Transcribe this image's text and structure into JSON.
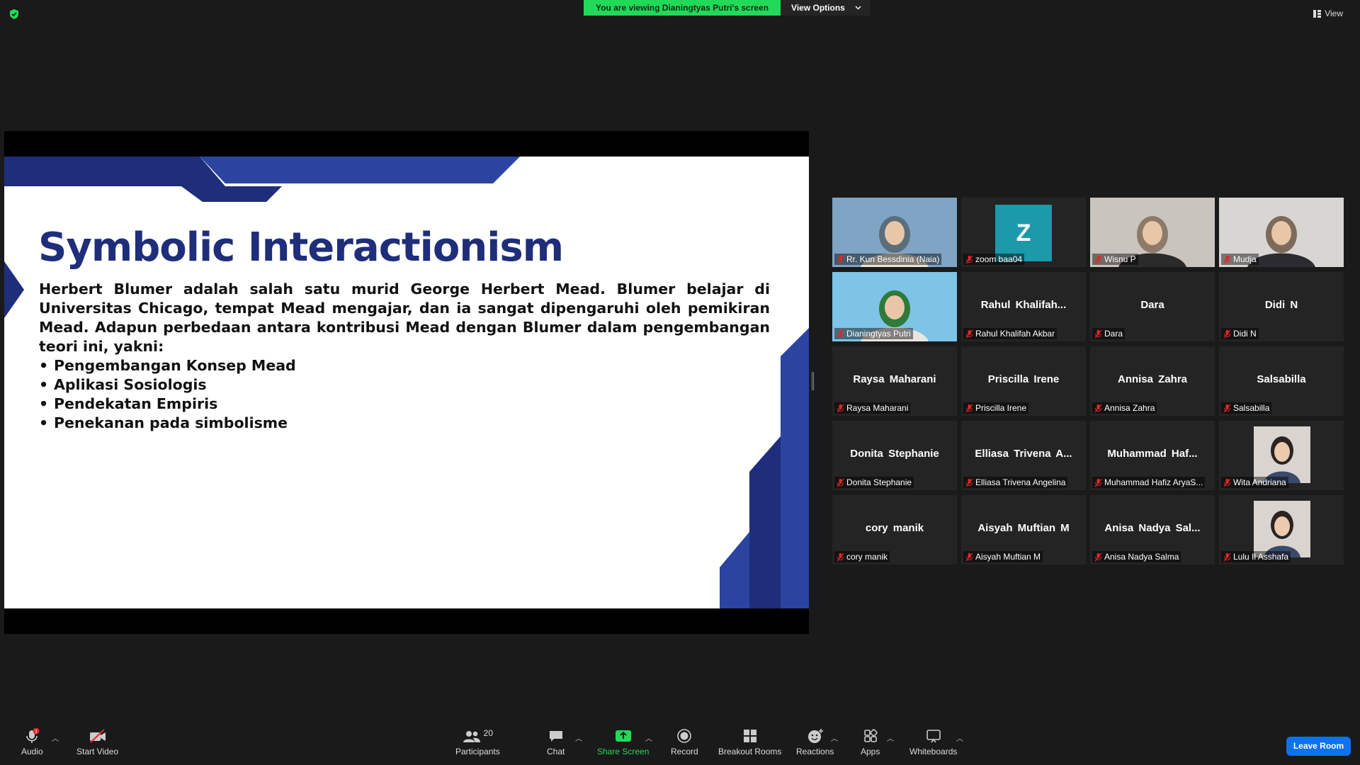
{
  "banner": {
    "viewing_text": "You are viewing Dianingtyas Putri's screen",
    "view_options_label": "View Options"
  },
  "view_label": "View",
  "slide": {
    "title": "Symbolic Interactionism",
    "paragraph": "Herbert Blumer adalah salah satu murid George Herbert Mead. Blumer belajar di Universitas Chicago, tempat Mead mengajar, dan ia sangat dipengaruhi oleh pemikiran Mead. Adapun perbedaan antara kontribusi Mead dengan Blumer dalam pengembangan teori ini, yakni:",
    "bullets": [
      "Pengembangan Konsep Mead",
      "Aplikasi Sosiologis",
      "Pendekatan Empiris",
      "Penekanan pada simbolisme"
    ]
  },
  "participants": [
    {
      "label": "Rr. Kun Bessdinia (Naia)",
      "big": "",
      "kind": "photo"
    },
    {
      "label": "zoom baa04",
      "big": "Z",
      "kind": "avatar"
    },
    {
      "label": "Wisnu P",
      "big": "",
      "kind": "photo"
    },
    {
      "label": "Mudja",
      "big": "",
      "kind": "photo"
    },
    {
      "label": "Dianingtyas Putri",
      "big": "",
      "kind": "photo",
      "active": true
    },
    {
      "label": "Rahul Khalifah Akbar",
      "big": "Rahul  Khalifah...",
      "kind": "name"
    },
    {
      "label": "Dara",
      "big": "Dara",
      "kind": "name"
    },
    {
      "label": "Didi N",
      "big": "Didi N",
      "kind": "name"
    },
    {
      "label": "Raysa Maharani",
      "big": "Raysa Maharani",
      "kind": "name"
    },
    {
      "label": "Priscilla Irene",
      "big": "Priscilla Irene",
      "kind": "name"
    },
    {
      "label": "Annisa Zahra",
      "big": "Annisa Zahra",
      "kind": "name"
    },
    {
      "label": "Salsabilla",
      "big": "Salsabilla",
      "kind": "name"
    },
    {
      "label": "Donita Stephanie",
      "big": "Donita Stephanie",
      "kind": "name"
    },
    {
      "label": "Elliasa Trivena Angelina",
      "big": "Elliasa  Trivena  A...",
      "kind": "name"
    },
    {
      "label": "Muhammad Hafiz AryaS...",
      "big": "Muhammad  Haf...",
      "kind": "name"
    },
    {
      "label": "Wita Andriana",
      "big": "",
      "kind": "thumb"
    },
    {
      "label": "cory manik",
      "big": "cory manik",
      "kind": "name"
    },
    {
      "label": "Aisyah Muftian M",
      "big": "Aisyah Muftian M",
      "kind": "name"
    },
    {
      "label": "Anisa Nadya Salma",
      "big": "Anisa  Nadya  Sal...",
      "kind": "name"
    },
    {
      "label": "Lulu Il Asshafa",
      "big": "",
      "kind": "thumb"
    }
  ],
  "toolbar": {
    "audio": "Audio",
    "start_video": "Start Video",
    "participants": "Participants",
    "participants_count": "20",
    "chat": "Chat",
    "share_screen": "Share Screen",
    "record": "Record",
    "breakout_rooms": "Breakout Rooms",
    "reactions": "Reactions",
    "apps": "Apps",
    "whiteboards": "Whiteboards",
    "leave": "Leave Room",
    "audio_badge": "!"
  },
  "colors": {
    "banner_green": "#23d959",
    "accent_blue": "#0e72ed",
    "slide_navy": "#1e2e7a",
    "slide_blue": "#2a44a0",
    "active_border": "#f7e46b"
  }
}
